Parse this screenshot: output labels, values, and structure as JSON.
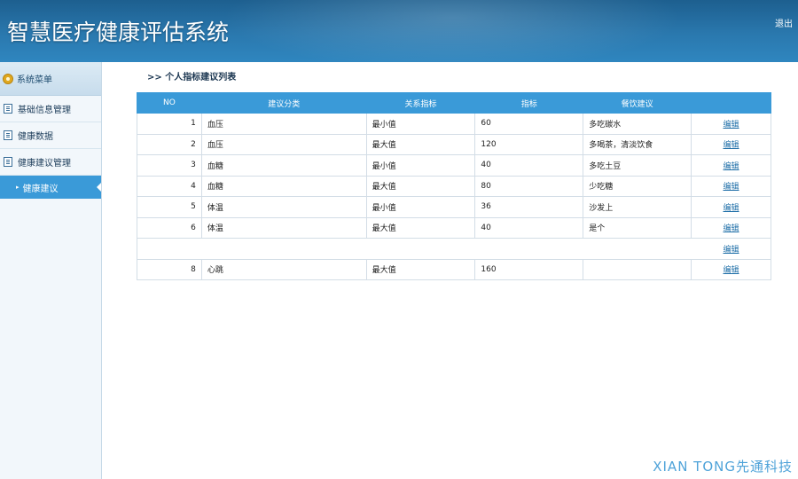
{
  "header": {
    "title": "智慧医疗健康评估系统",
    "logout": "退出"
  },
  "sidebar": {
    "menu_title": "系统菜单",
    "items": [
      {
        "label": "基础信息管理"
      },
      {
        "label": "健康数据"
      },
      {
        "label": "健康建议管理"
      }
    ],
    "active_sub": "健康建议"
  },
  "main": {
    "breadcrumb": ">> 个人指标建议列表",
    "table": {
      "headers": [
        "NO",
        "建议分类",
        "关系指标",
        "指标",
        "餐饮建议",
        ""
      ],
      "rows": [
        {
          "no": "1",
          "category": "血压",
          "relation": "最小值",
          "value": "60",
          "advice": "多吃碳水",
          "op": "编辑"
        },
        {
          "no": "2",
          "category": "血压",
          "relation": "最大值",
          "value": "120",
          "advice": "多喝茶，清淡饮食",
          "op": "编辑"
        },
        {
          "no": "3",
          "category": "血糖",
          "relation": "最小值",
          "value": "40",
          "advice": "多吃土豆",
          "op": "编辑"
        },
        {
          "no": "4",
          "category": "血糖",
          "relation": "最大值",
          "value": "80",
          "advice": "少吃糖",
          "op": "编辑"
        },
        {
          "no": "5",
          "category": "体温",
          "relation": "最小值",
          "value": "36",
          "advice": "沙发上",
          "op": "编辑"
        },
        {
          "no": "6",
          "category": "体温",
          "relation": "最大值",
          "value": "40",
          "advice": "是个",
          "op": "编辑"
        },
        {
          "no": "",
          "category": "",
          "relation": "",
          "value": "",
          "advice": "",
          "op": "编辑"
        },
        {
          "no": "8",
          "category": "心跳",
          "relation": "最大值",
          "value": "160",
          "advice": "",
          "op": "编辑"
        }
      ]
    }
  },
  "watermark": "XIAN TONG先通科技"
}
